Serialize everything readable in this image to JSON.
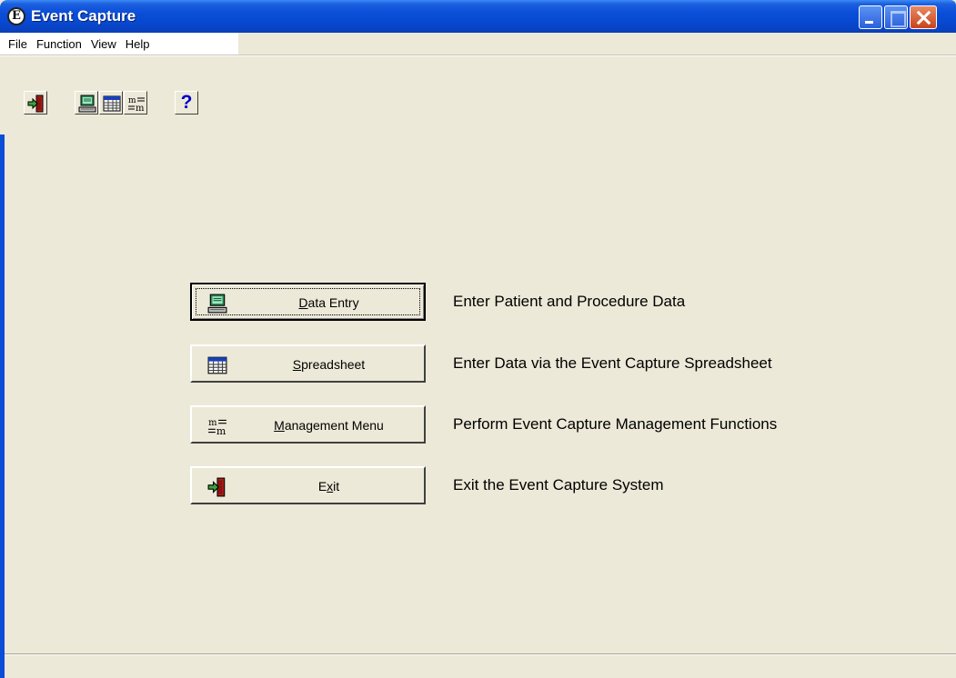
{
  "window": {
    "title": "Event Capture",
    "app_icon_glyph": "E"
  },
  "menu": {
    "items": [
      "File",
      "Function",
      "View",
      "Help"
    ]
  },
  "toolbar": {
    "help_glyph": "?"
  },
  "commands": [
    {
      "label_pre": "",
      "label_ul": "D",
      "label_post": "ata Entry",
      "description": "Enter Patient and Procedure Data",
      "icon": "data-entry-icon"
    },
    {
      "label_pre": "",
      "label_ul": "S",
      "label_post": "preadsheet",
      "description": "Enter Data via the Event Capture Spreadsheet",
      "icon": "spreadsheet-icon"
    },
    {
      "label_pre": "",
      "label_ul": "M",
      "label_post": "anagement Menu",
      "description": "Perform Event Capture Management Functions",
      "icon": "management-menu-icon"
    },
    {
      "label_pre": "E",
      "label_ul": "x",
      "label_post": "it",
      "description": "Exit the Event Capture System",
      "icon": "exit-icon"
    }
  ],
  "colors": {
    "titlebar": "#0A4ED8",
    "window_bg": "#ECE9D8",
    "help_blue": "#0000C8"
  }
}
